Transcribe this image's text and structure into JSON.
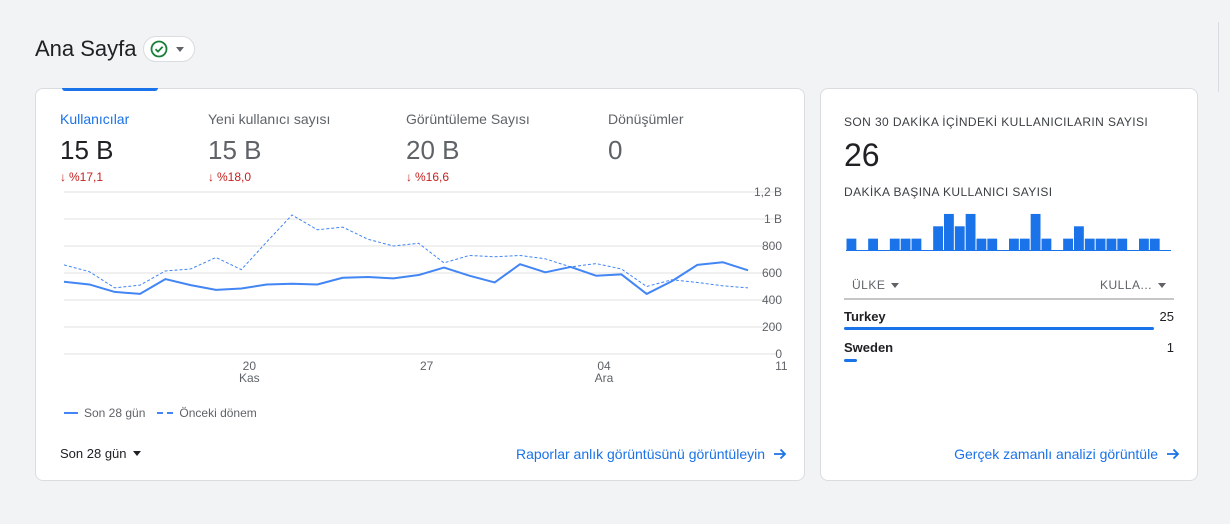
{
  "page": {
    "title": "Ana Sayfa"
  },
  "main_card": {
    "metrics": [
      {
        "label": "Kullanıcılar",
        "value": "15 B",
        "change": "%17,1",
        "direction": "down",
        "active": true
      },
      {
        "label": "Yeni kullanıcı sayısı",
        "value": "15 B",
        "change": "%18,0",
        "direction": "down",
        "active": false
      },
      {
        "label": "Görüntüleme Sayısı",
        "value": "20 B",
        "change": "%16,6",
        "direction": "down",
        "active": false
      },
      {
        "label": "Dönüşümler",
        "value": "0",
        "change": "",
        "direction": "",
        "active": false
      }
    ],
    "legend": {
      "current": "Son 28 gün",
      "previous": "Önceki dönem"
    },
    "range_select": "Son 28 gün",
    "link": "Raporlar anlık görüntüsünü görüntüleyin"
  },
  "chart_data": {
    "type": "line",
    "y_tick_labels": [
      "1,2 B",
      "1 B",
      "800",
      "600",
      "400",
      "200",
      "0"
    ],
    "y_ticks": [
      1200,
      1000,
      800,
      600,
      400,
      200,
      0
    ],
    "ylim": [
      0,
      1200
    ],
    "x_ticks": [
      {
        "label": "20",
        "sub": "Kas",
        "index": 4
      },
      {
        "label": "27",
        "sub": "",
        "index": 11
      },
      {
        "label": "04",
        "sub": "Ara",
        "index": 18
      },
      {
        "label": "11",
        "sub": "",
        "index": 25
      }
    ],
    "grid": true,
    "series": [
      {
        "name": "Son 28 gün",
        "style": "solid",
        "color": "#4285f4",
        "values": [
          535,
          515,
          460,
          445,
          555,
          510,
          475,
          485,
          515,
          520,
          515,
          565,
          570,
          560,
          585,
          640,
          580,
          530,
          665,
          605,
          645,
          580,
          590,
          445,
          540,
          660,
          680,
          620
        ]
      },
      {
        "name": "Önceki dönem",
        "style": "dashed",
        "color": "#4285f4",
        "values": [
          660,
          610,
          490,
          510,
          615,
          630,
          715,
          625,
          830,
          1030,
          920,
          940,
          850,
          800,
          820,
          675,
          730,
          720,
          730,
          705,
          645,
          670,
          630,
          500,
          550,
          530,
          505,
          490
        ]
      }
    ],
    "colors": {
      "primary": "#4285f4",
      "grid": "#e0e0e0"
    }
  },
  "realtime": {
    "title": "SON 30 DAKİKA İÇİNDEKİ KULLANICILARIN SAYISI",
    "value": "26",
    "subtitle": "DAKİKA BAŞINA KULLANICI SAYISI",
    "bars": [
      1,
      0,
      1,
      0,
      1,
      1,
      1,
      0,
      2,
      3,
      2,
      3,
      1,
      1,
      0,
      1,
      1,
      3,
      1,
      0,
      1,
      2,
      1,
      1,
      1,
      1,
      0,
      1,
      1,
      0
    ],
    "table": {
      "col1": "ÜLKE",
      "col2": "KULLA...",
      "rows": [
        {
          "name": "Turkey",
          "value": "25",
          "share": 0.96
        },
        {
          "name": "Sweden",
          "value": "1",
          "share": 0.04
        }
      ]
    },
    "link": "Gerçek zamanlı analizi görüntüle"
  }
}
